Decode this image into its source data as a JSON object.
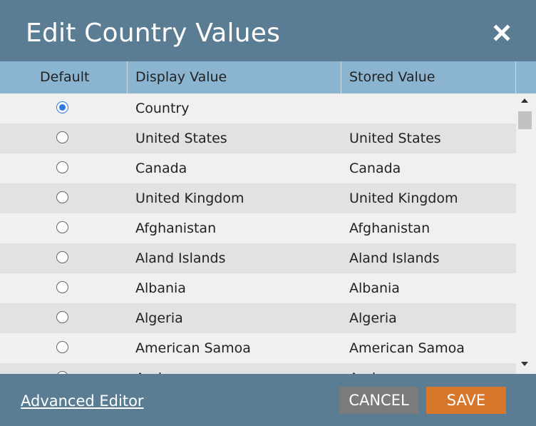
{
  "dialog": {
    "title": "Edit Country Values"
  },
  "table": {
    "headers": {
      "default": "Default",
      "display": "Display Value",
      "stored": "Stored Value"
    },
    "rows": [
      {
        "selected": true,
        "display": "Country",
        "stored": ""
      },
      {
        "selected": false,
        "display": "United States",
        "stored": "United States"
      },
      {
        "selected": false,
        "display": "Canada",
        "stored": "Canada"
      },
      {
        "selected": false,
        "display": "United Kingdom",
        "stored": "United Kingdom"
      },
      {
        "selected": false,
        "display": "Afghanistan",
        "stored": "Afghanistan"
      },
      {
        "selected": false,
        "display": "Aland Islands",
        "stored": "Aland Islands"
      },
      {
        "selected": false,
        "display": "Albania",
        "stored": "Albania"
      },
      {
        "selected": false,
        "display": "Algeria",
        "stored": "Algeria"
      },
      {
        "selected": false,
        "display": "American Samoa",
        "stored": "American Samoa"
      },
      {
        "selected": false,
        "display": "Andorra",
        "stored": "Andorra"
      }
    ]
  },
  "footer": {
    "advanced_editor": "Advanced Editor",
    "cancel": "CANCEL",
    "save": "SAVE"
  },
  "colors": {
    "header_bg": "#5b7d93",
    "column_header_bg": "#8ab4d0",
    "save_button": "#d8772b",
    "cancel_button": "#7b7b7b",
    "radio_selected": "#2b7ae0"
  },
  "icons": {
    "close": "close-icon"
  }
}
